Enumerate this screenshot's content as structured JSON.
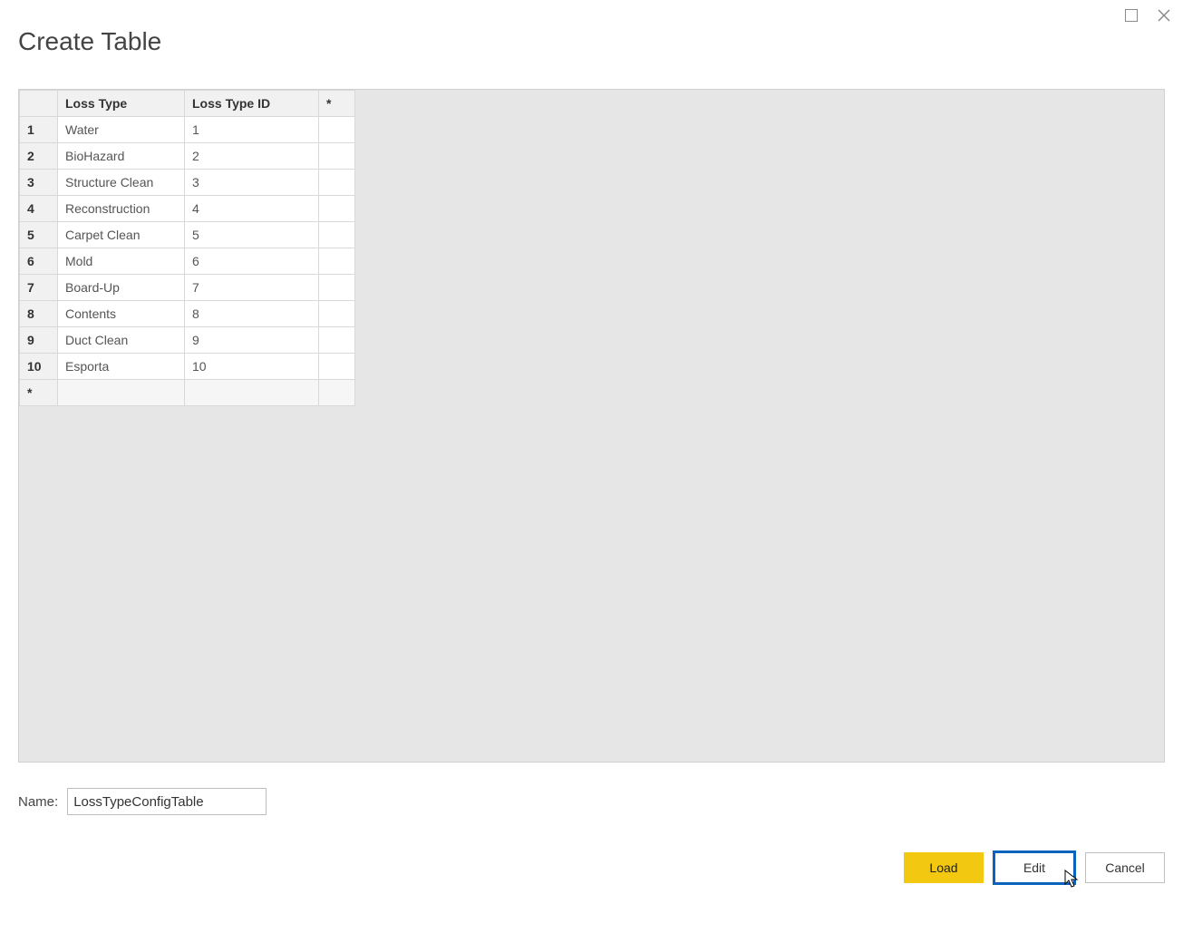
{
  "window": {
    "title": "Create Table"
  },
  "table": {
    "columns": {
      "loss_type": "Loss Type",
      "loss_type_id": "Loss Type ID",
      "star": "*"
    },
    "rows": [
      {
        "n": "1",
        "loss_type": "Water",
        "loss_type_id": "1"
      },
      {
        "n": "2",
        "loss_type": "BioHazard",
        "loss_type_id": "2"
      },
      {
        "n": "3",
        "loss_type": "Structure Clean",
        "loss_type_id": "3"
      },
      {
        "n": "4",
        "loss_type": "Reconstruction",
        "loss_type_id": "4"
      },
      {
        "n": "5",
        "loss_type": "Carpet Clean",
        "loss_type_id": "5"
      },
      {
        "n": "6",
        "loss_type": "Mold",
        "loss_type_id": "6"
      },
      {
        "n": "7",
        "loss_type": "Board-Up",
        "loss_type_id": "7"
      },
      {
        "n": "8",
        "loss_type": "Contents",
        "loss_type_id": "8"
      },
      {
        "n": "9",
        "loss_type": "Duct Clean",
        "loss_type_id": "9"
      },
      {
        "n": "10",
        "loss_type": "Esporta",
        "loss_type_id": "10"
      }
    ],
    "new_row_marker": "*"
  },
  "name": {
    "label": "Name:",
    "value": "LossTypeConfigTable"
  },
  "buttons": {
    "load": "Load",
    "edit": "Edit",
    "cancel": "Cancel"
  }
}
